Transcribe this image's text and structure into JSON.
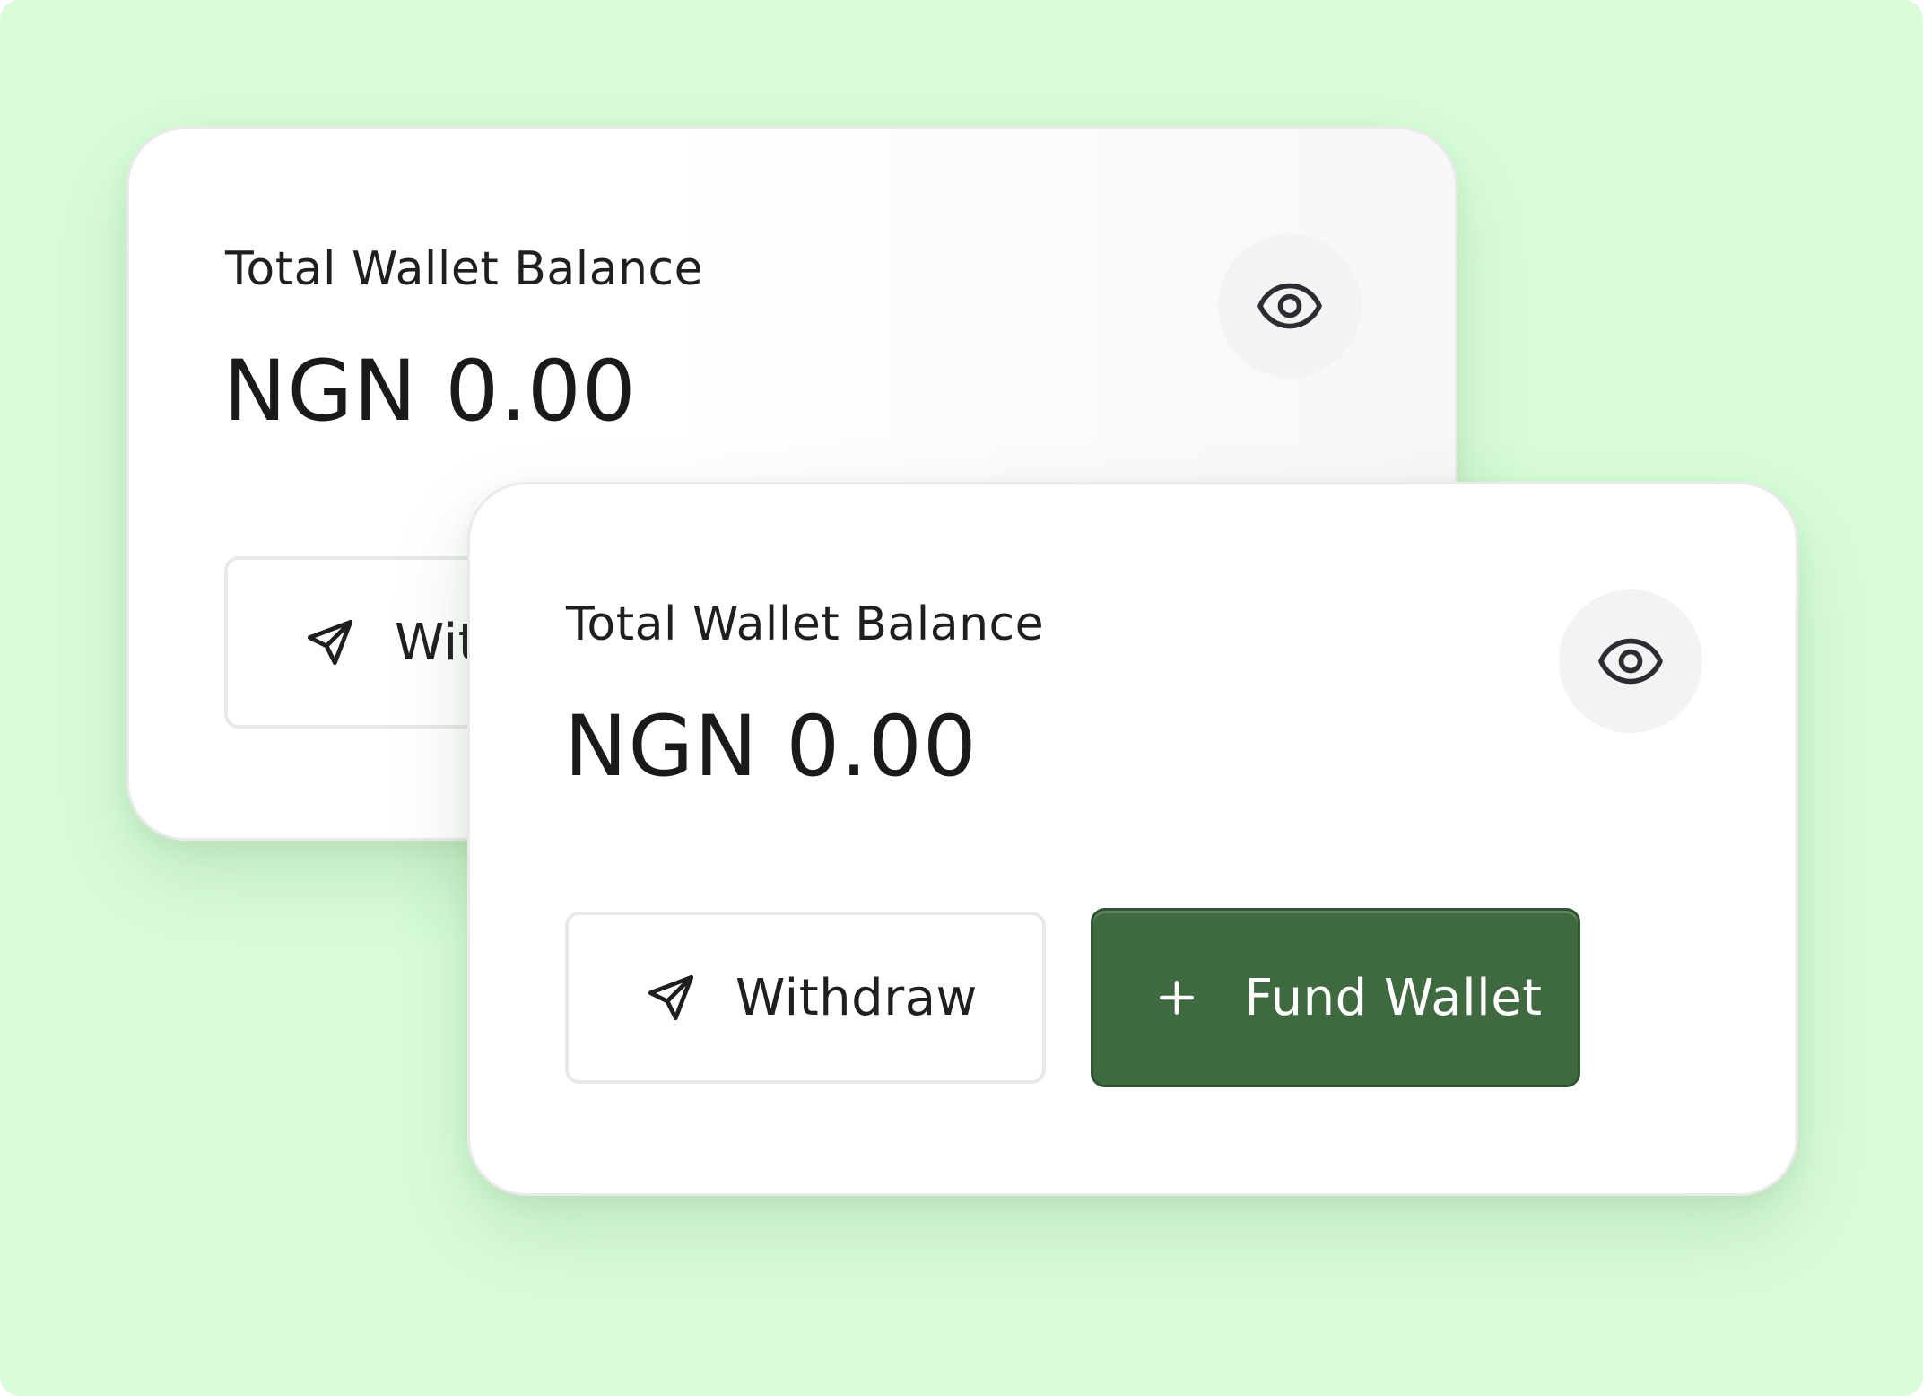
{
  "back_card": {
    "title": "Total Wallet Balance",
    "amount": "NGN 0.00",
    "withdraw_label": "Withdraw",
    "visibility_icon": "eye-icon",
    "withdraw_icon": "send-icon"
  },
  "front_card": {
    "title": "Total Wallet Balance",
    "amount": "NGN 0.00",
    "withdraw_label": "Withdraw",
    "fund_label": "Fund Wallet",
    "visibility_icon": "eye-icon",
    "withdraw_icon": "send-icon",
    "fund_icon": "plus-icon"
  },
  "colors": {
    "background": "#d9fdd9",
    "card": "#ffffff",
    "primary_button": "#3f6a40",
    "icon_circle": "#f3f3f4",
    "text": "#1f1f1f"
  }
}
